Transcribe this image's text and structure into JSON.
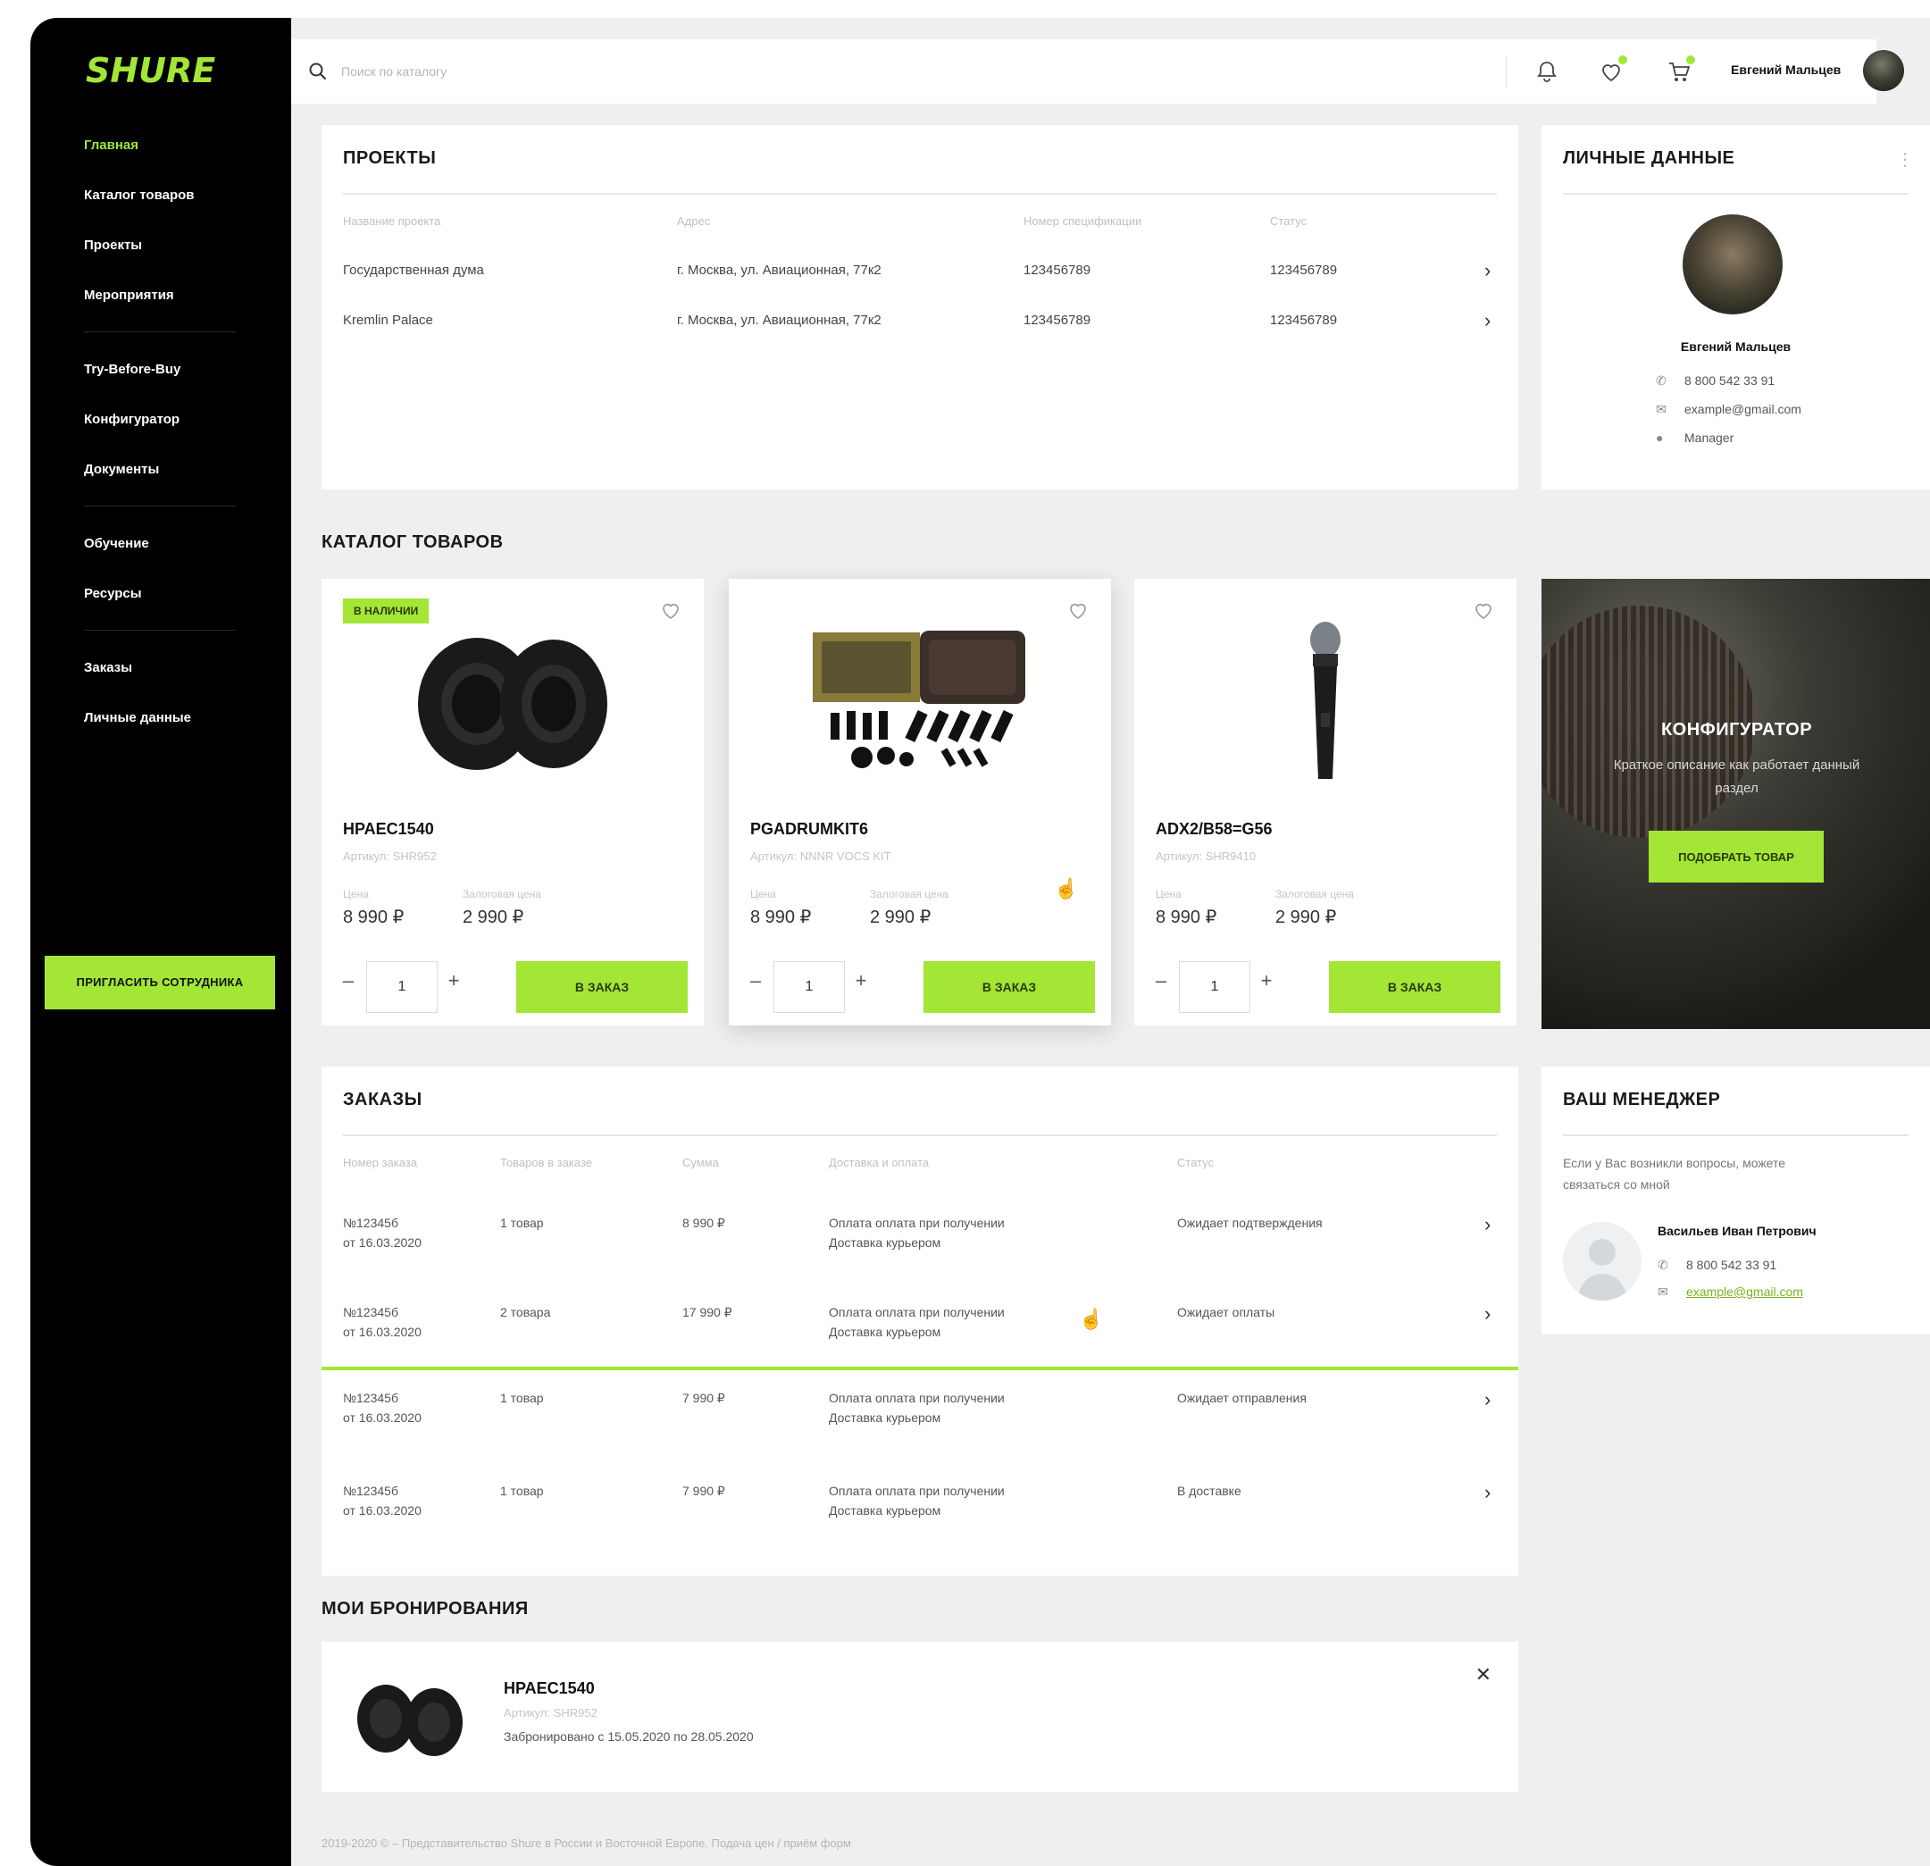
{
  "brand": {
    "logo_text": "SHURE",
    "accent": "#a3e635",
    "sidebar_bg": "#000000",
    "page_bg": "#efefef"
  },
  "sidebar": {
    "groups": [
      [
        {
          "label": "Главная",
          "icon": "home",
          "active": true
        },
        {
          "label": "Каталог товаров",
          "icon": "catalog"
        },
        {
          "label": "Проекты",
          "icon": "projects"
        },
        {
          "label": "Мероприятия",
          "icon": "events"
        }
      ],
      [
        {
          "label": "Try-Before-Buy",
          "icon": "try"
        },
        {
          "label": "Конфигуратор",
          "icon": "configurator"
        },
        {
          "label": "Документы",
          "icon": "documents"
        }
      ],
      [
        {
          "label": "Обучение",
          "icon": "learning"
        },
        {
          "label": "Ресурсы",
          "icon": "resources"
        }
      ],
      [
        {
          "label": "Заказы",
          "icon": "orders"
        },
        {
          "label": "Личные данные",
          "icon": "profile"
        }
      ]
    ],
    "invite_button": "ПРИГЛАСИТЬ СОТРУДНИКА"
  },
  "topbar": {
    "search_placeholder": "Поиск по каталогу",
    "user_name": "Евгений Мальцев",
    "icons": [
      "bell-icon",
      "heart-icon",
      "cart-icon"
    ]
  },
  "projects": {
    "title": "ПРОЕКТЫ",
    "columns": [
      "Название проекта",
      "Адрес",
      "Номер спецификации",
      "Статус"
    ],
    "rows": [
      [
        "Государственная дума",
        "г. Москва, ул. Авиационная, 77к2",
        "123456789",
        "123456789"
      ],
      [
        "Kremlin Palace",
        "г. Москва, ул. Авиационная, 77к2",
        "123456789",
        "123456789"
      ]
    ]
  },
  "personal": {
    "title": "ЛИЧНЫЕ ДАННЫЕ",
    "name": "Евгений Мальцев",
    "phone": "8 800 542 33 91",
    "email": "example@gmail.com",
    "role": "Manager"
  },
  "catalog": {
    "title": "КАТАЛОГ ТОВАРОВ",
    "price_label": "Цена",
    "deposit_label": "Залоговая цена",
    "qty_default": "1",
    "order_label": "В ЗАКАЗ",
    "products": [
      {
        "badge": "В НАЛИЧИИ",
        "sku": "HPAEC1540",
        "article": "Артикул: SHR952",
        "price": "8 990 ₽",
        "deposit": "2 990 ₽",
        "image": "earpads"
      },
      {
        "badge": "",
        "sku": "PGADRUMKIT6",
        "article": "Артикул: NNNR VOCS KIT",
        "price": "8 990 ₽",
        "deposit": "2 990 ₽",
        "image": "drumkit"
      },
      {
        "badge": "",
        "sku": "ADX2/B58=G56",
        "article": "Артикул: SHR9410",
        "price": "8 990 ₽",
        "deposit": "2 990 ₽",
        "image": "microphone"
      }
    ]
  },
  "configurator": {
    "title": "КОНФИГУРАТОР",
    "description": "Краткое описание как работает данный раздел",
    "button": "ПОДОБРАТЬ ТОВАР"
  },
  "orders": {
    "title": "ЗАКАЗЫ",
    "columns": [
      "Номер заказа",
      "Товаров в заказе",
      "Сумма",
      "Доставка и оплата",
      "Статус"
    ],
    "rows": [
      {
        "number": "№12345б",
        "date": "от 16.03.2020",
        "items": "1 товар",
        "sum": "8 990 ₽",
        "pay": "Оплата оплата при получении",
        "delivery": "Доставка курьером",
        "status": "Ожидает подтверждения"
      },
      {
        "number": "№12345б",
        "date": "от 16.03.2020",
        "items": "2 товара",
        "sum": "17 990 ₽",
        "pay": "Оплата оплата при получении",
        "delivery": "Доставка курьером",
        "status": "Ожидает оплаты"
      },
      {
        "number": "№12345б",
        "date": "от 16.03.2020",
        "items": "1 товар",
        "sum": "7 990 ₽",
        "pay": "Оплата оплата при получении",
        "delivery": "Доставка курьером",
        "status": "Ожидает отправления"
      },
      {
        "number": "№12345б",
        "date": "от 16.03.2020",
        "items": "1 товар",
        "sum": "7 990 ₽",
        "pay": "Оплата оплата при получении",
        "delivery": "Доставка курьером",
        "status": "В доставке"
      }
    ]
  },
  "manager": {
    "title": "ВАШ МЕНЕДЖЕР",
    "description": "Если у Вас возникли вопросы, можете связаться со мной",
    "name": "Васильев Иван Петрович",
    "phone": "8 800 542 33 91",
    "email": "example@gmail.com"
  },
  "bookings": {
    "title": "МОИ БРОНИРОВАНИЯ",
    "item": {
      "sku": "HPAEC1540",
      "article": "Артикул: SHR952",
      "dates": "Забронировано с 15.05.2020 по 28.05.2020"
    }
  },
  "footer": "2019-2020 © – Представительство Shure в России и Восточной Европе. Подача цен / приём форм"
}
